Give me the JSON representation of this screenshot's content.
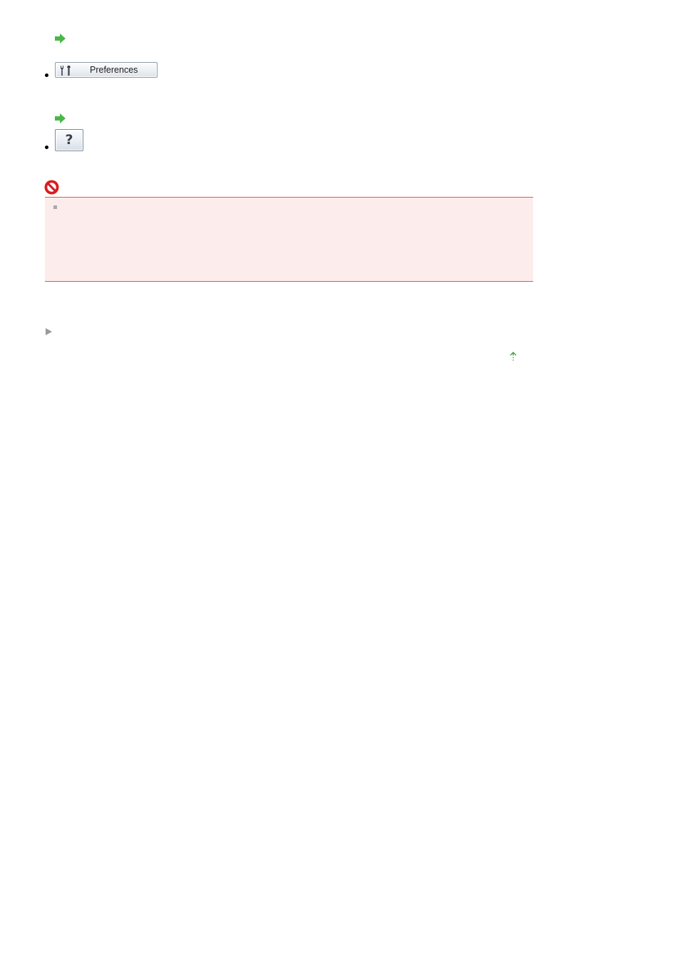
{
  "preferences_button": {
    "label": "Preferences",
    "icon": "tools-icon"
  },
  "help_button": {
    "label": "?",
    "icon": "question-mark-icon"
  },
  "important_note": {
    "icon": "prohibited-icon",
    "bullet_icon": "square-bullet-icon"
  },
  "links": {
    "go_arrow_icon": "green-right-arrow-icon",
    "nav_icon": "gray-triangle-icon",
    "page_top_icon": "green-up-arrow-icon"
  },
  "colors": {
    "arrow_green": "#4cb648",
    "important_red": "#d81e1e",
    "important_bg": "#fdecec",
    "important_border": "#d85a5a"
  }
}
